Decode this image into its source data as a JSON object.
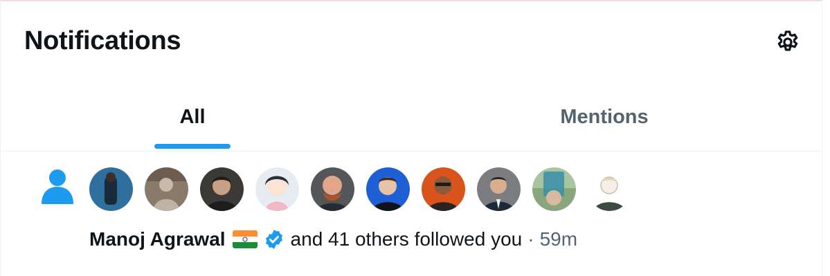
{
  "header": {
    "title": "Notifications",
    "settings_icon": "gear-icon"
  },
  "tabs": [
    {
      "label": "All",
      "active": true
    },
    {
      "label": "Mentions",
      "active": false
    }
  ],
  "colors": {
    "accent": "#1d9bf0",
    "text": "#0f1419",
    "muted": "#536471"
  },
  "notification": {
    "type_icon": "person-icon",
    "avatars": [
      {
        "name": "avatar-1"
      },
      {
        "name": "avatar-2"
      },
      {
        "name": "avatar-3"
      },
      {
        "name": "avatar-4"
      },
      {
        "name": "avatar-5"
      },
      {
        "name": "avatar-6"
      },
      {
        "name": "avatar-7"
      },
      {
        "name": "avatar-8"
      },
      {
        "name": "avatar-9"
      },
      {
        "name": "avatar-10"
      }
    ],
    "user_name": "Manoj Agrawal",
    "flag": "india-flag-icon",
    "verified": "verified-badge-icon",
    "text": "and 41 others followed you",
    "separator": "·",
    "time": "59m"
  }
}
